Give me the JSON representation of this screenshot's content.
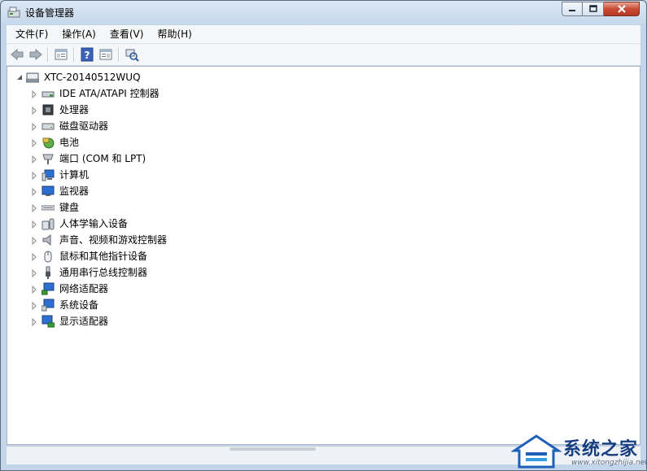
{
  "window": {
    "title": "设备管理器"
  },
  "menu": [
    {
      "label": "文件(F)"
    },
    {
      "label": "操作(A)"
    },
    {
      "label": "查看(V)"
    },
    {
      "label": "帮助(H)"
    }
  ],
  "toolbar": {
    "buttons": [
      "back-arrow-icon",
      "forward-arrow-icon",
      "properties-panel-icon",
      "help-icon",
      "action-pane-icon",
      "scan-hardware-icon"
    ]
  },
  "tree": {
    "root": {
      "label": "XTC-20140512WUQ",
      "icon": "computer-icon",
      "expanded": true
    },
    "children": [
      {
        "label": "IDE ATA/ATAPI 控制器",
        "icon": "ide-controller-icon"
      },
      {
        "label": "处理器",
        "icon": "processor-icon"
      },
      {
        "label": "磁盘驱动器",
        "icon": "disk-drive-icon"
      },
      {
        "label": "电池",
        "icon": "battery-icon"
      },
      {
        "label": "端口 (COM 和 LPT)",
        "icon": "port-icon"
      },
      {
        "label": "计算机",
        "icon": "computer-icon"
      },
      {
        "label": "监视器",
        "icon": "monitor-icon"
      },
      {
        "label": "键盘",
        "icon": "keyboard-icon"
      },
      {
        "label": "人体学输入设备",
        "icon": "hid-icon"
      },
      {
        "label": "声音、视频和游戏控制器",
        "icon": "speaker-icon"
      },
      {
        "label": "鼠标和其他指针设备",
        "icon": "mouse-icon"
      },
      {
        "label": "通用串行总线控制器",
        "icon": "usb-icon"
      },
      {
        "label": "网络适配器",
        "icon": "network-adapter-icon"
      },
      {
        "label": "系统设备",
        "icon": "system-device-icon"
      },
      {
        "label": "显示适配器",
        "icon": "display-adapter-icon"
      }
    ]
  },
  "watermark": {
    "brand": "系统之家",
    "url": "www.xitongzhijia.net",
    "accent": "#173e7f"
  },
  "colors": {
    "chrome": "#c3d5ea",
    "menu_bg": "#f5f6f7",
    "close_button": "#c74b34"
  }
}
